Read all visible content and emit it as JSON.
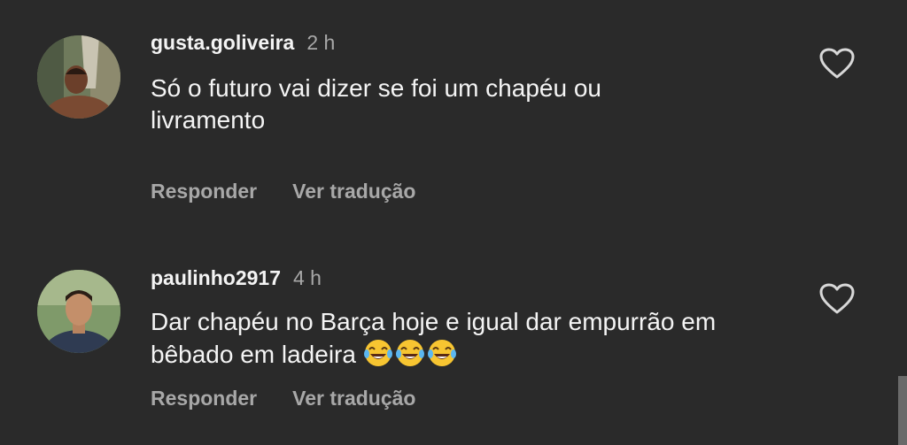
{
  "comments": [
    {
      "username": "gusta.goliveira",
      "time": "2 h",
      "text_line1": "Só o futuro vai dizer se foi um chapéu ou",
      "text_line2": "livramento",
      "reply_label": "Responder",
      "translate_label": "Ver tradução"
    },
    {
      "username": "paulinho2917",
      "time": "4 h",
      "text_line1": "Dar chapéu no Barça hoje e igual dar empurrão em",
      "text_line2": "bêbado em ladeira",
      "emojis": [
        "laughing-tears-emoji",
        "laughing-tears-emoji",
        "laughing-tears-emoji"
      ],
      "reply_label": "Responder",
      "translate_label": "Ver tradução"
    }
  ],
  "colors": {
    "background": "#2a2a2a",
    "primary_text": "#f4f4f4",
    "secondary_text": "#a8a8a8",
    "heart_outline": "#d8d8d8"
  },
  "icons": [
    "heart-outline-icon",
    "avatar-photo"
  ]
}
